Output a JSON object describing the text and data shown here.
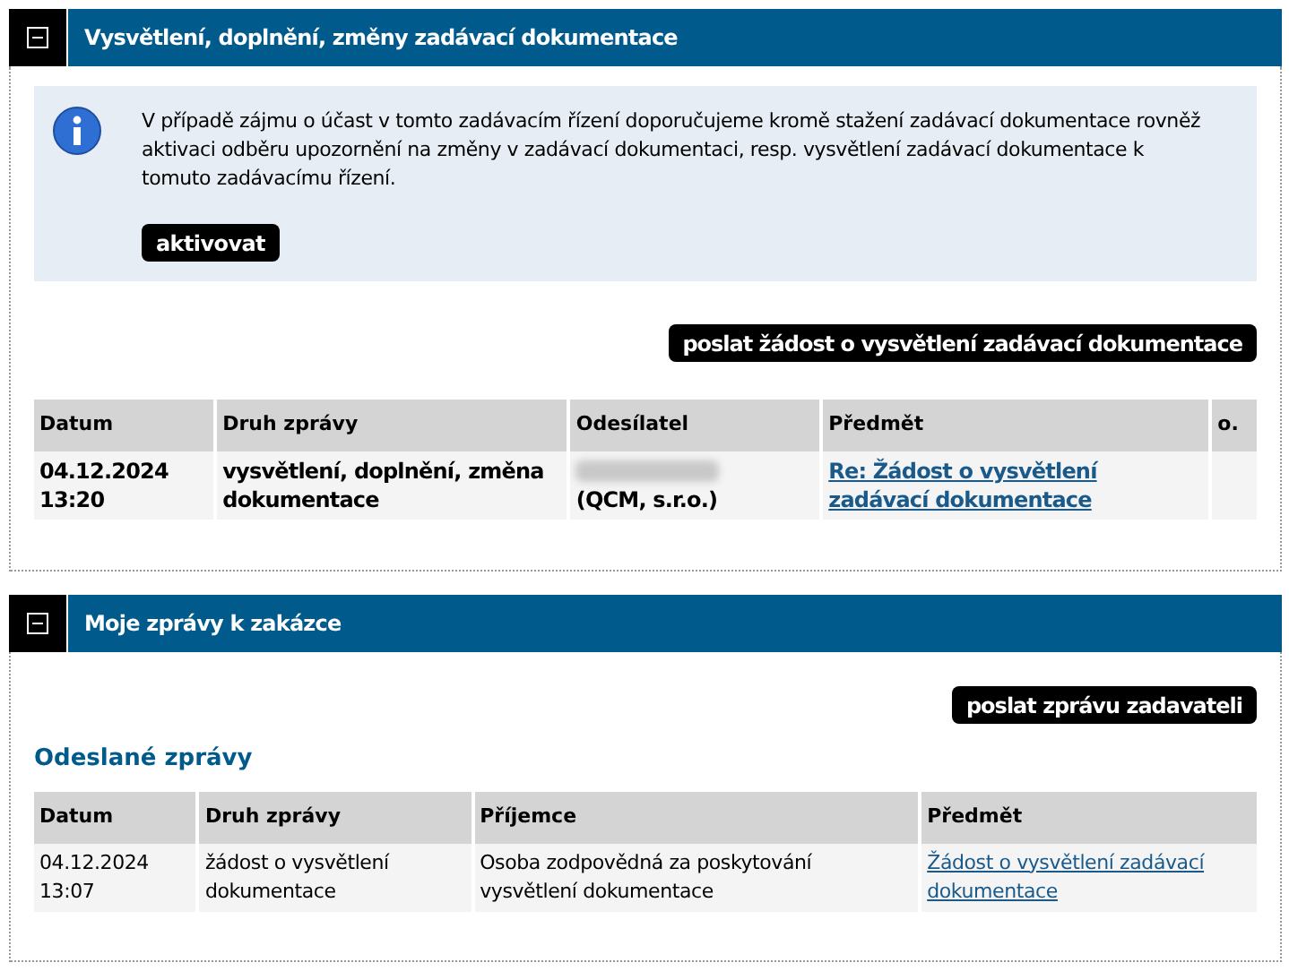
{
  "sections": [
    {
      "title": "Vysvětlení, doplnění, změny zadávací dokumentace",
      "expanded": true,
      "info": {
        "text": "V případě zájmu o účast v tomto zadávacím řízení doporučujeme kromě stažení zadávací dokumentace rovněž aktivaci odběru upozornění na změny v zadávací dokumentaci, resp. vysvětlení zadávací dokumentace k tomuto zadávacímu řízení.",
        "button": "aktivovat"
      },
      "action_button": "poslat žádost o vysvětlení zadávací dokumentace",
      "table": {
        "bold_rows": true,
        "columns": [
          "Datum",
          "Druh zprávy",
          "Odesílatel",
          "Předmět",
          "o."
        ],
        "rows": [
          {
            "cells": [
              "04.12.2024\n13:20",
              "vysvětlení, doplnění, změna dokumentace",
              "(QCM, s.r.o.)",
              "Re: Žádost o vysvětlení zadávací dokumentace",
              ""
            ],
            "redacted": true
          }
        ]
      }
    },
    {
      "title": "Moje zprávy k zakázce",
      "expanded": true,
      "action_button": "poslat zprávu zadavateli",
      "subheading": "Odeslané zprávy",
      "table": {
        "bold_rows": false,
        "columns": [
          "Datum",
          "Druh zprávy",
          "Příjemce",
          "Předmět"
        ],
        "rows": [
          {
            "cells": [
              "04.12.2024\n13:07",
              "žádost o vysvětlení dokumentace",
              "Osoba zodpovědná za poskytování vysvětlení dokumentace",
              "Žádost o vysvětlení zadávací dokumentace"
            ],
            "redacted": false
          }
        ]
      }
    }
  ]
}
